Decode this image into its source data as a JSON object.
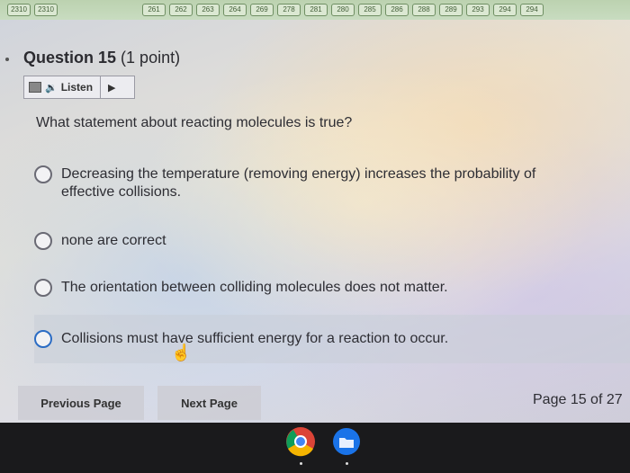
{
  "progress_pages": [
    "2310",
    "2310",
    "261",
    "262",
    "263",
    "264",
    "269",
    "278",
    "281",
    "280",
    "285",
    "286",
    "288",
    "289",
    "293",
    "294",
    "294"
  ],
  "question": {
    "title": "Question 15",
    "points": "(1 point)",
    "text": "What statement about reacting molecules is true?"
  },
  "listen": {
    "label": "Listen",
    "speaker_icon": "speaker-icon",
    "play_icon": "play-icon"
  },
  "options": [
    {
      "label": "Decreasing the temperature (removing energy) increases the probability of effective collisions."
    },
    {
      "label": "none are correct"
    },
    {
      "label": "The orientation between colliding molecules does not matter."
    },
    {
      "label": "Collisions must have sufficient energy for a reaction to occur."
    }
  ],
  "navigation": {
    "previous": "Previous Page",
    "next": "Next Page",
    "page_indicator": "Page 15 of 27"
  },
  "taskbar": {
    "apps": [
      "chrome-icon",
      "files-icon"
    ]
  },
  "colors": {
    "radio_highlight": "#2b6cc4",
    "taskbar": "#1a1a1c"
  }
}
